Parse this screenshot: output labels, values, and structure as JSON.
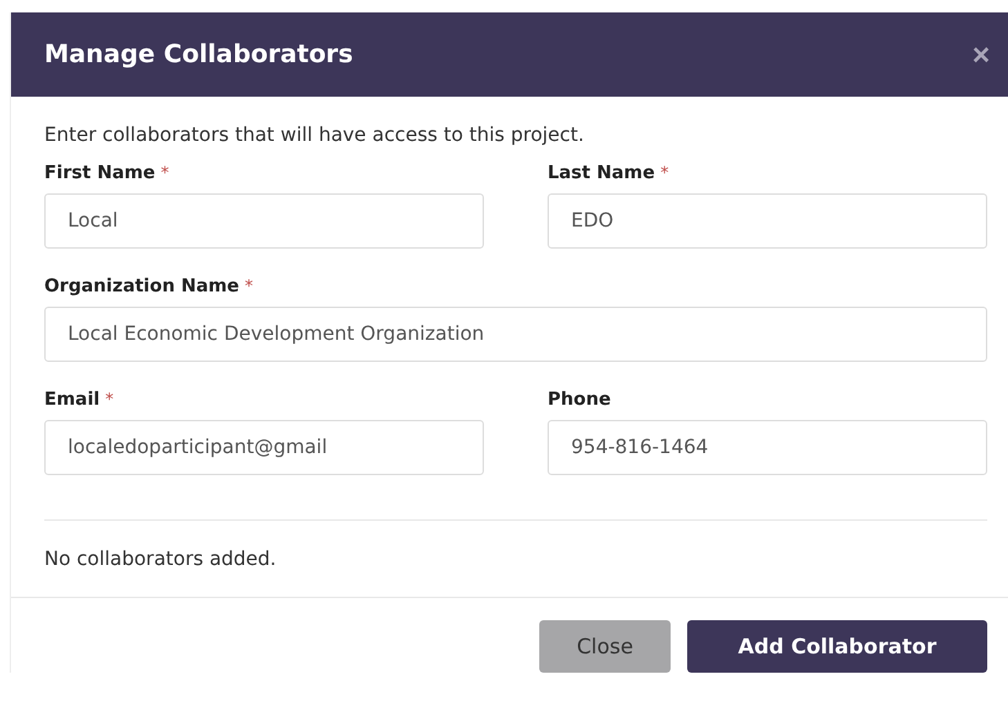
{
  "dialog": {
    "title": "Manage Collaborators",
    "close_icon": "×",
    "intro": "Enter collaborators that will have access to this project.",
    "field_rows": [
      [
        {
          "label": "First Name",
          "required_mark": "*",
          "value": "Local"
        },
        {
          "label": "Last Name",
          "required_mark": "*",
          "value": "EDO"
        }
      ],
      [
        {
          "label": "Organization Name",
          "required_mark": "*",
          "value": "Local Economic Development Organization"
        }
      ],
      [
        {
          "label": "Email",
          "required_mark": "*",
          "value": "localedoparticipant@gmail"
        },
        {
          "label": "Phone",
          "value": "954-816-1464"
        }
      ]
    ],
    "empty_message": "No collaborators added.",
    "buttons": [
      {
        "label": "Close",
        "kind": "secondary"
      },
      {
        "label": "Add Collaborator",
        "kind": "primary"
      }
    ]
  }
}
